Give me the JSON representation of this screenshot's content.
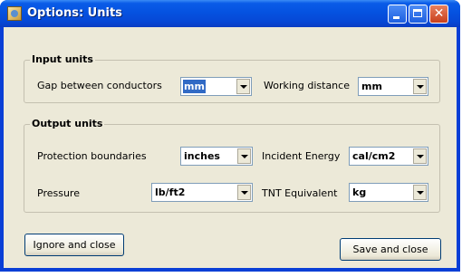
{
  "window": {
    "title": "Options: Units"
  },
  "input_units": {
    "heading": "Input units",
    "gap_label": "Gap between conductors",
    "gap_value": "mm",
    "distance_label": "Working distance",
    "distance_value": "mm"
  },
  "output_units": {
    "heading": "Output units",
    "protection_label": "Protection boundaries",
    "protection_value": "inches",
    "energy_label": "Incident Energy",
    "energy_value": "cal/cm2",
    "pressure_label": "Pressure",
    "pressure_value": "lb/ft2",
    "tnt_label": "TNT Equivalent",
    "tnt_value": "kg"
  },
  "buttons": {
    "ignore_label": "Ignore and close",
    "save_label": "Save and close"
  }
}
